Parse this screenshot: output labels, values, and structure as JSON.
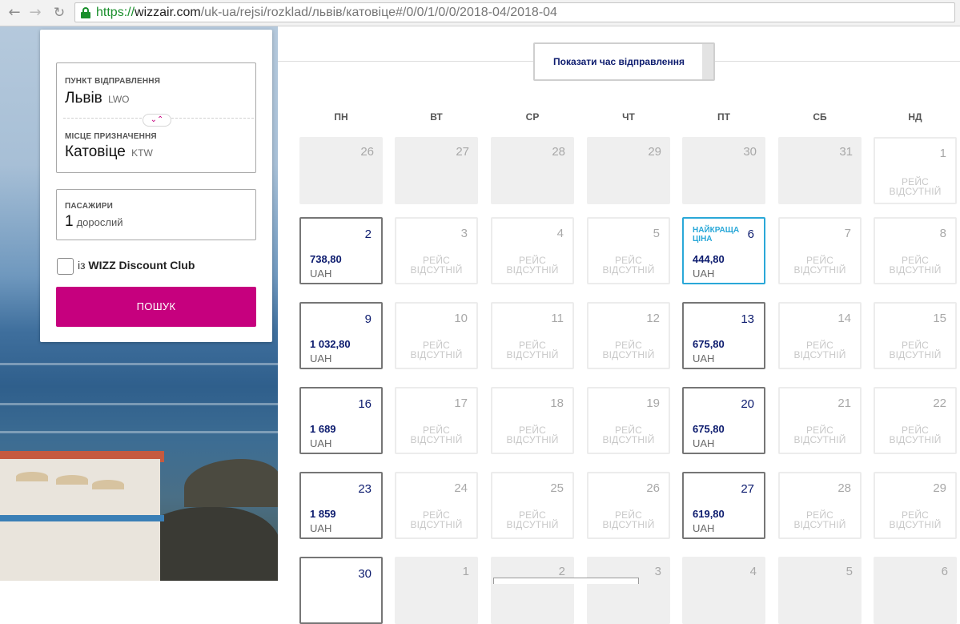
{
  "browser": {
    "url_scheme": "https://",
    "url_host": "wizzair.com",
    "url_path": "/uk-ua/rejsi/rozklad/львів/катовіце#/0/0/1/0/0/2018-04/2018-04"
  },
  "form": {
    "origin_label": "ПУНКТ ВІДПРАВЛЕННЯ",
    "origin_city": "Львів",
    "origin_code": "LWO",
    "destination_label": "МІСЦЕ ПРИЗНАЧЕННЯ",
    "destination_city": "Катовіце",
    "destination_code": "KTW",
    "passengers_label": "ПАСАЖИРИ",
    "passengers_count": "1",
    "passengers_unit": "дорослий",
    "club_prefix": "із",
    "club_name": "WIZZ Discount Club",
    "search_label": "ПОШУК"
  },
  "calendar": {
    "show_times_label": "Показати час відправлення",
    "weekdays": [
      "ПН",
      "ВТ",
      "СР",
      "ЧТ",
      "ПТ",
      "СБ",
      "НД"
    ],
    "no_flight_line1": "РЕЙС",
    "no_flight_line2": "ВІДСУТНІЙ",
    "best_price_label": "НАЙКРАЩА ЦІНА",
    "currency": "UAH",
    "days": [
      {
        "day": "26",
        "state": "prev"
      },
      {
        "day": "27",
        "state": "prev"
      },
      {
        "day": "28",
        "state": "prev"
      },
      {
        "day": "29",
        "state": "prev"
      },
      {
        "day": "30",
        "state": "prev"
      },
      {
        "day": "31",
        "state": "prev"
      },
      {
        "day": "1",
        "state": "none"
      },
      {
        "day": "2",
        "state": "avail",
        "price": "738,80"
      },
      {
        "day": "3",
        "state": "none"
      },
      {
        "day": "4",
        "state": "none"
      },
      {
        "day": "5",
        "state": "none"
      },
      {
        "day": "6",
        "state": "best",
        "price": "444,80"
      },
      {
        "day": "7",
        "state": "none"
      },
      {
        "day": "8",
        "state": "none"
      },
      {
        "day": "9",
        "state": "avail",
        "price": "1 032,80"
      },
      {
        "day": "10",
        "state": "none"
      },
      {
        "day": "11",
        "state": "none"
      },
      {
        "day": "12",
        "state": "none"
      },
      {
        "day": "13",
        "state": "avail",
        "price": "675,80"
      },
      {
        "day": "14",
        "state": "none"
      },
      {
        "day": "15",
        "state": "none"
      },
      {
        "day": "16",
        "state": "avail",
        "price": "1 689"
      },
      {
        "day": "17",
        "state": "none"
      },
      {
        "day": "18",
        "state": "none"
      },
      {
        "day": "19",
        "state": "none"
      },
      {
        "day": "20",
        "state": "avail",
        "price": "675,80"
      },
      {
        "day": "21",
        "state": "none"
      },
      {
        "day": "22",
        "state": "none"
      },
      {
        "day": "23",
        "state": "avail",
        "price": "1 859"
      },
      {
        "day": "24",
        "state": "none"
      },
      {
        "day": "25",
        "state": "none"
      },
      {
        "day": "26",
        "state": "none"
      },
      {
        "day": "27",
        "state": "avail",
        "price": "619,80"
      },
      {
        "day": "28",
        "state": "none"
      },
      {
        "day": "29",
        "state": "none"
      },
      {
        "day": "30",
        "state": "avail-partial"
      },
      {
        "day": "1",
        "state": "next"
      },
      {
        "day": "2",
        "state": "next"
      },
      {
        "day": "3",
        "state": "next"
      },
      {
        "day": "4",
        "state": "next"
      },
      {
        "day": "5",
        "state": "next"
      },
      {
        "day": "6",
        "state": "next"
      }
    ]
  }
}
